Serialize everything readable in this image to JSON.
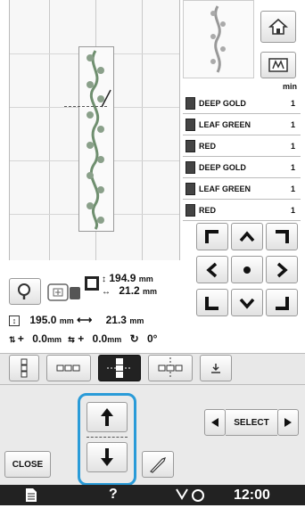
{
  "size_info": {
    "height_value": "194.9",
    "height_unit": "mm",
    "width_value": "21.2",
    "width_unit": "mm"
  },
  "total_size": {
    "height_value": "195.0",
    "height_unit": "mm",
    "width_value": "21.3",
    "width_unit": "mm"
  },
  "position": {
    "x_sign": "+",
    "x_value": "0.0",
    "x_unit": "mm",
    "y_sign": "+",
    "y_value": "0.0",
    "y_unit": "mm",
    "rotation": "0°"
  },
  "thread_list": {
    "header": "min",
    "items": [
      {
        "name": "DEEP GOLD",
        "count": "1"
      },
      {
        "name": "LEAF GREEN",
        "count": "1"
      },
      {
        "name": "RED",
        "count": "1"
      },
      {
        "name": "DEEP GOLD",
        "count": "1"
      },
      {
        "name": "LEAF GREEN",
        "count": "1"
      },
      {
        "name": "RED",
        "count": "1"
      }
    ]
  },
  "buttons": {
    "close_label": "CLOSE",
    "select_label": "SELECT"
  },
  "status_bar": {
    "time": "12:00",
    "help": "?"
  },
  "colors": {
    "highlight": "#2a9bd8",
    "status_bar": "#222222",
    "embroidery_green": "#6f8f6f"
  },
  "icons": [
    "home-icon",
    "embroidery-mode-icon",
    "zoom-icon",
    "frame-icon",
    "size-icon",
    "arrow-up-icon",
    "arrow-down-icon",
    "needle-icon",
    "select-left-icon",
    "select-right-icon",
    "document-icon",
    "bobbin-icon",
    "rotate-icon"
  ]
}
